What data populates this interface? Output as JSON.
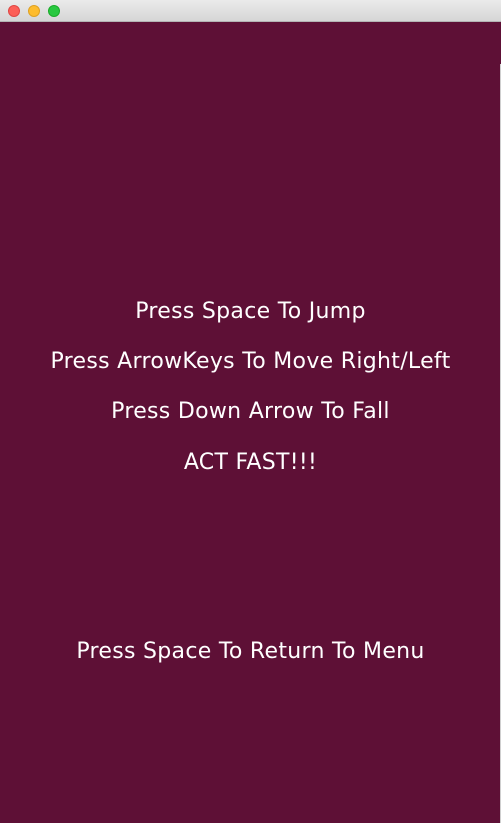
{
  "colors": {
    "background": "#5e1036",
    "text": "#ffffff"
  },
  "instructions": [
    "Press Space To Jump",
    "Press ArrowKeys To Move Right/Left",
    "Press Down Arrow To Fall",
    "ACT FAST!!!"
  ],
  "footer_prompt": "Press Space To Return To Menu"
}
